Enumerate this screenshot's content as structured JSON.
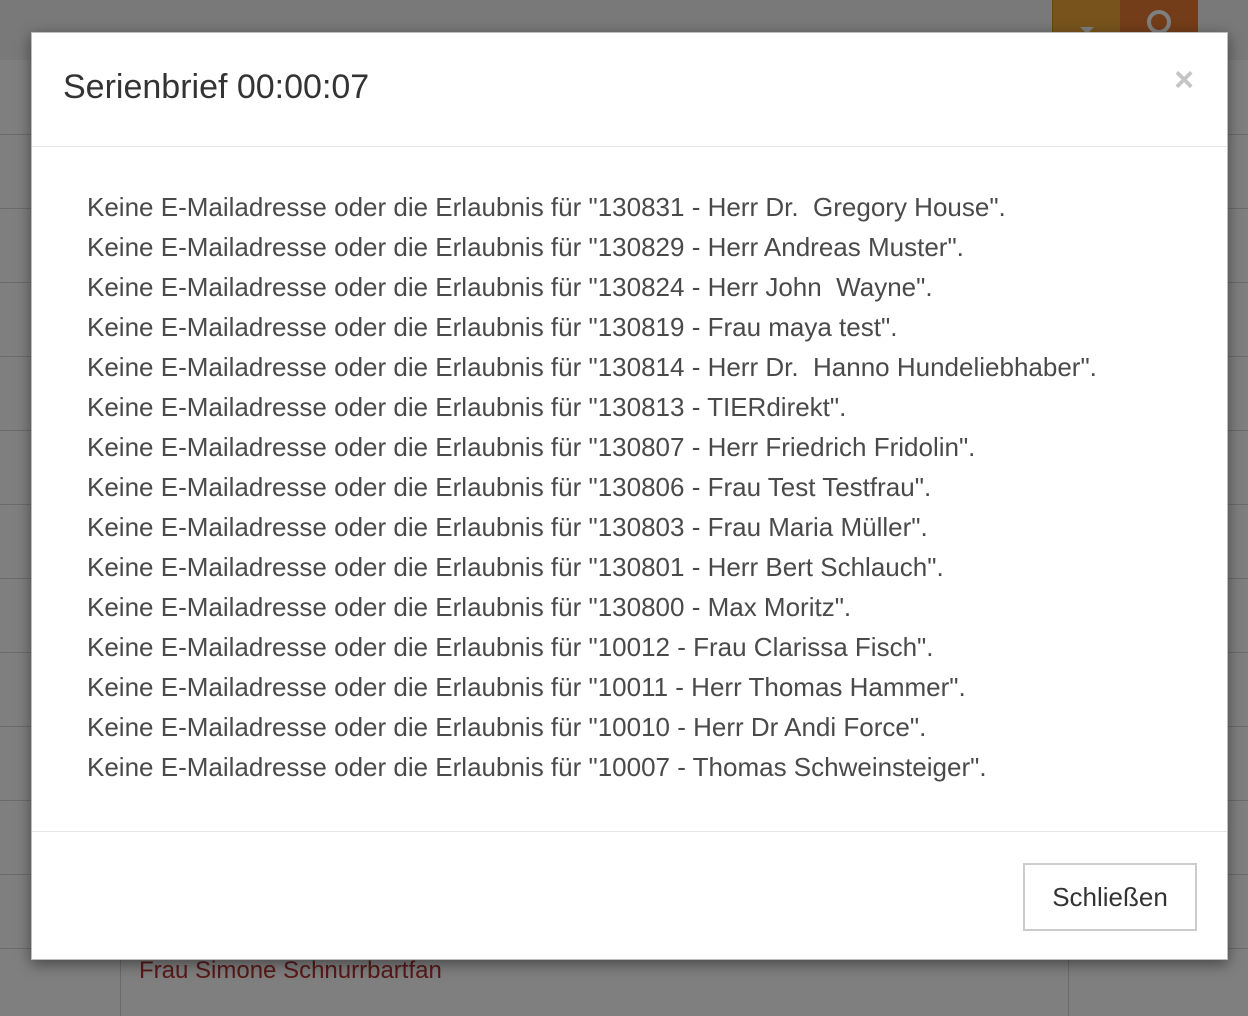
{
  "background": {
    "dropdown_icon": "caret-down-icon",
    "search_icon": "search-icon",
    "row_text": "Frau Simone Schnurrbartfan",
    "row_text_color": "#b33030"
  },
  "modal": {
    "title": "Serienbrief 00:00:07",
    "close_icon": "×",
    "messages": [
      "Keine E-Mailadresse oder die Erlaubnis für \"130831 - Herr Dr.  Gregory House\".",
      "Keine E-Mailadresse oder die Erlaubnis für \"130829 - Herr Andreas Muster\".",
      "Keine E-Mailadresse oder die Erlaubnis für \"130824 - Herr John  Wayne\".",
      "Keine E-Mailadresse oder die Erlaubnis für \"130819 - Frau maya test\".",
      "Keine E-Mailadresse oder die Erlaubnis für \"130814 - Herr Dr.  Hanno Hundeliebhaber\".",
      "Keine E-Mailadresse oder die Erlaubnis für \"130813 - TIERdirekt\".",
      "Keine E-Mailadresse oder die Erlaubnis für \"130807 - Herr Friedrich Fridolin\".",
      "Keine E-Mailadresse oder die Erlaubnis für \"130806 - Frau Test Testfrau\".",
      "Keine E-Mailadresse oder die Erlaubnis für \"130803 - Frau Maria Müller\".",
      "Keine E-Mailadresse oder die Erlaubnis für \"130801 - Herr Bert Schlauch\".",
      "Keine E-Mailadresse oder die Erlaubnis für \"130800 - Max Moritz\".",
      "Keine E-Mailadresse oder die Erlaubnis für \"10012 - Frau Clarissa Fisch\".",
      "Keine E-Mailadresse oder die Erlaubnis für \"10011 - Herr Thomas Hammer\".",
      "Keine E-Mailadresse oder die Erlaubnis für \"10010 - Herr Dr Andi Force\".",
      "Keine E-Mailadresse oder die Erlaubnis für \"10007 - Thomas Schweinsteiger\"."
    ],
    "close_button_label": "Schließen"
  },
  "colors": {
    "dropdown_button": "#f0a838",
    "search_button": "#e67a33",
    "backdrop": "rgba(0,0,0,0.5)"
  }
}
